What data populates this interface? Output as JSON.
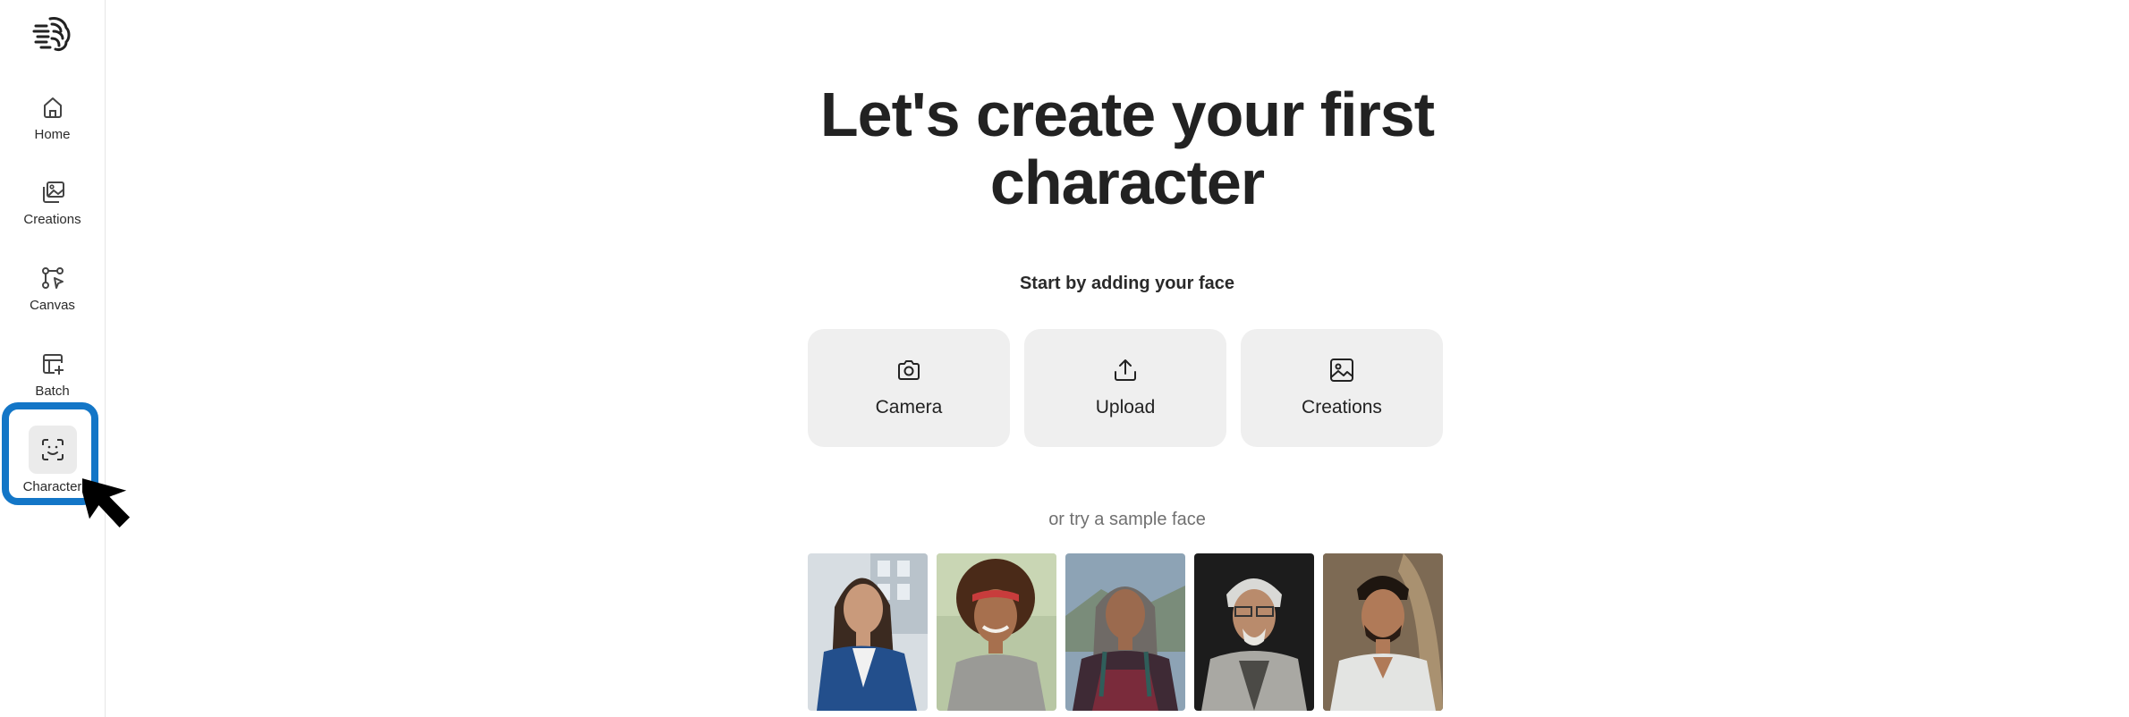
{
  "sidebar": {
    "logo_icon": "brain-logo-icon",
    "items": [
      {
        "label": "Home",
        "icon": "home-icon"
      },
      {
        "label": "Creations",
        "icon": "images-icon"
      },
      {
        "label": "Canvas",
        "icon": "nodes-icon"
      },
      {
        "label": "Batch",
        "icon": "grid-plus-icon"
      },
      {
        "label": "Character",
        "icon": "face-scan-icon",
        "active": true
      }
    ]
  },
  "annotation": {
    "highlight_color": "#1376c7",
    "cursor": "arrow-cursor-icon"
  },
  "main": {
    "title_line1": "Let's create your first",
    "title_line2": "character",
    "subtitle": "Start by adding your face",
    "options": [
      {
        "label": "Camera",
        "icon": "camera-icon"
      },
      {
        "label": "Upload",
        "icon": "upload-icon"
      },
      {
        "label": "Creations",
        "icon": "image-icon"
      }
    ],
    "sample_label": "or try a sample face",
    "sample_faces": [
      "sample-face-1",
      "sample-face-2",
      "sample-face-3",
      "sample-face-4",
      "sample-face-5"
    ]
  },
  "colors": {
    "option_bg": "#efefef",
    "active_bg": "#ebebeb"
  }
}
